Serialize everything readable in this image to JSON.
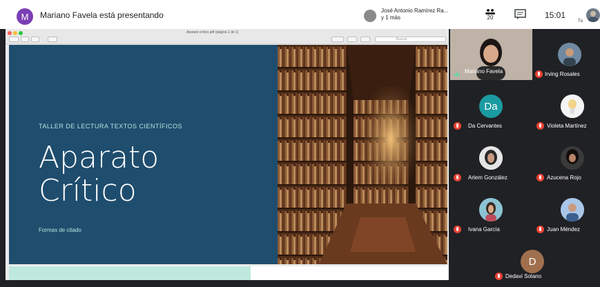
{
  "topbar": {
    "presenter_initial": "M",
    "presenter_text": "Mariano Favela está presentando",
    "also_presenting_line1": "José Antonio Ramírez Ra...",
    "also_presenting_line2": "y 1 más",
    "people_count": "20",
    "clock": "15:01",
    "self_label": "Tú"
  },
  "doc_window": {
    "title": "Aparato crítico.pdf (página 1 de 1)",
    "search_placeholder": "Buscar"
  },
  "slide": {
    "kicker": "TALLER DE LECTURA TEXTOS CIENTÍFICOS",
    "title": "Aparato\nCrítico",
    "subtitle": "Formas de citado",
    "colors": {
      "background": "#1f4d6e",
      "accent_text": "#b5e7dd",
      "title": "#ffffff"
    }
  },
  "participants": [
    {
      "name": "Mariano Favela",
      "speaking": true
    },
    {
      "name": "Irving Rosales",
      "muted": true
    },
    {
      "name": "Da Cervantes",
      "initials": "Da",
      "color": "#1a9ba1",
      "muted": true
    },
    {
      "name": "Violeta Martínez",
      "muted": true
    },
    {
      "name": "Arlem González",
      "muted": true
    },
    {
      "name": "Azucena Rojo",
      "muted": true
    },
    {
      "name": "Ivana García",
      "muted": true
    },
    {
      "name": "Juan Méndez",
      "muted": true
    },
    {
      "name": "Dedavi Solano",
      "initials": "D",
      "color": "#a06f4e",
      "muted": true
    }
  ]
}
